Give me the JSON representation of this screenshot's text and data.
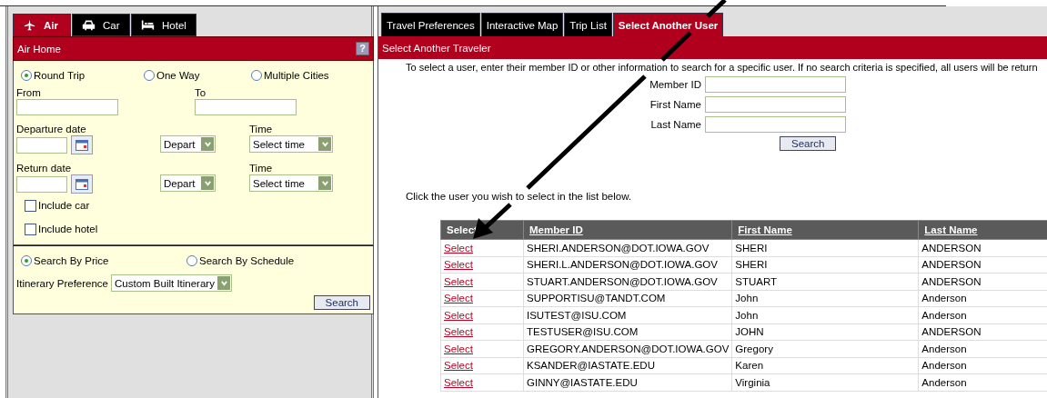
{
  "left_panel": {
    "tabs": [
      {
        "label": "Air",
        "kind": "plane",
        "selected": true
      },
      {
        "label": "Car",
        "kind": "car",
        "selected": false
      },
      {
        "label": "Hotel",
        "kind": "bed",
        "selected": false
      }
    ],
    "header": {
      "title": "Air Home",
      "help": "?"
    },
    "trip_types": [
      {
        "label": "Round Trip",
        "selected": true
      },
      {
        "label": "One Way",
        "selected": false
      },
      {
        "label": "Multiple Cities",
        "selected": false
      }
    ],
    "from": {
      "label": "From"
    },
    "to": {
      "label": "To"
    },
    "departure": {
      "label": "Departure date",
      "direction": "Depart",
      "time_label": "Time",
      "time": "Select time"
    },
    "return": {
      "label": "Return date",
      "direction": "Depart",
      "time_label": "Time",
      "time": "Select time"
    },
    "options": [
      {
        "label": "Include car",
        "checked": false
      },
      {
        "label": "Include hotel",
        "checked": false
      }
    ],
    "search_modes": [
      {
        "label": "Search By Price",
        "selected": true
      },
      {
        "label": "Search By Schedule",
        "selected": false
      }
    ],
    "itinerary": {
      "label": "Itinerary Preference",
      "value": "Custom Built Itinerary"
    },
    "search_button": "Search"
  },
  "right_panel": {
    "tabs": [
      {
        "label": "Travel Preferences",
        "selected": false
      },
      {
        "label": "Interactive Map",
        "selected": false
      },
      {
        "label": "Trip List",
        "selected": false
      },
      {
        "label": "Select Another User",
        "selected": true
      }
    ],
    "header": "Select Another Traveler",
    "intro": "To select a user, enter their member ID or other information to search for a specific user.  If no search criteria is specified, all users will be return",
    "fields": [
      {
        "label": "Member ID"
      },
      {
        "label": "First Name"
      },
      {
        "label": "Last Name"
      }
    ],
    "search_button": "Search",
    "hint": "Click the user you wish to select in the list below.",
    "table": {
      "columns": [
        {
          "label": "Select",
          "sortable": false
        },
        {
          "label": "Member ID",
          "sortable": true
        },
        {
          "label": "First Name",
          "sortable": true
        },
        {
          "label": "Last Name",
          "sortable": true
        }
      ],
      "rows": [
        {
          "link": "Select",
          "member_id": "SHERI.ANDERSON@DOT.IOWA.GOV",
          "first_name": "SHERI",
          "last_name": "ANDERSON"
        },
        {
          "link": "Select",
          "member_id": "SHERI.L.ANDERSON@DOT.IOWA.GOV",
          "first_name": "SHERI",
          "last_name": "ANDERSON"
        },
        {
          "link": "Select",
          "member_id": "STUART.ANDERSON@DOT.IOWA.GOV",
          "first_name": "STUART",
          "last_name": "ANDERSON"
        },
        {
          "link": "Select",
          "member_id": "SUPPORTISU@TANDT.COM",
          "first_name": "John",
          "last_name": "Anderson"
        },
        {
          "link": "Select",
          "member_id": "ISUTEST@ISU.COM",
          "first_name": "John",
          "last_name": "Anderson"
        },
        {
          "link": "Select",
          "member_id": "TESTUSER@ISU.COM",
          "first_name": "JOHN",
          "last_name": "ANDERSON"
        },
        {
          "link": "Select",
          "member_id": "GREGORY.ANDERSON@DOT.IOWA.GOV",
          "first_name": "Gregory",
          "last_name": "Anderson"
        },
        {
          "link": "Select",
          "member_id": "KSANDER@IASTATE.EDU",
          "first_name": "Karen",
          "last_name": "Anderson"
        },
        {
          "link": "Select",
          "member_id": "GINNY@IASTATE.EDU",
          "first_name": "Virginia",
          "last_name": "Anderson"
        }
      ]
    }
  }
}
